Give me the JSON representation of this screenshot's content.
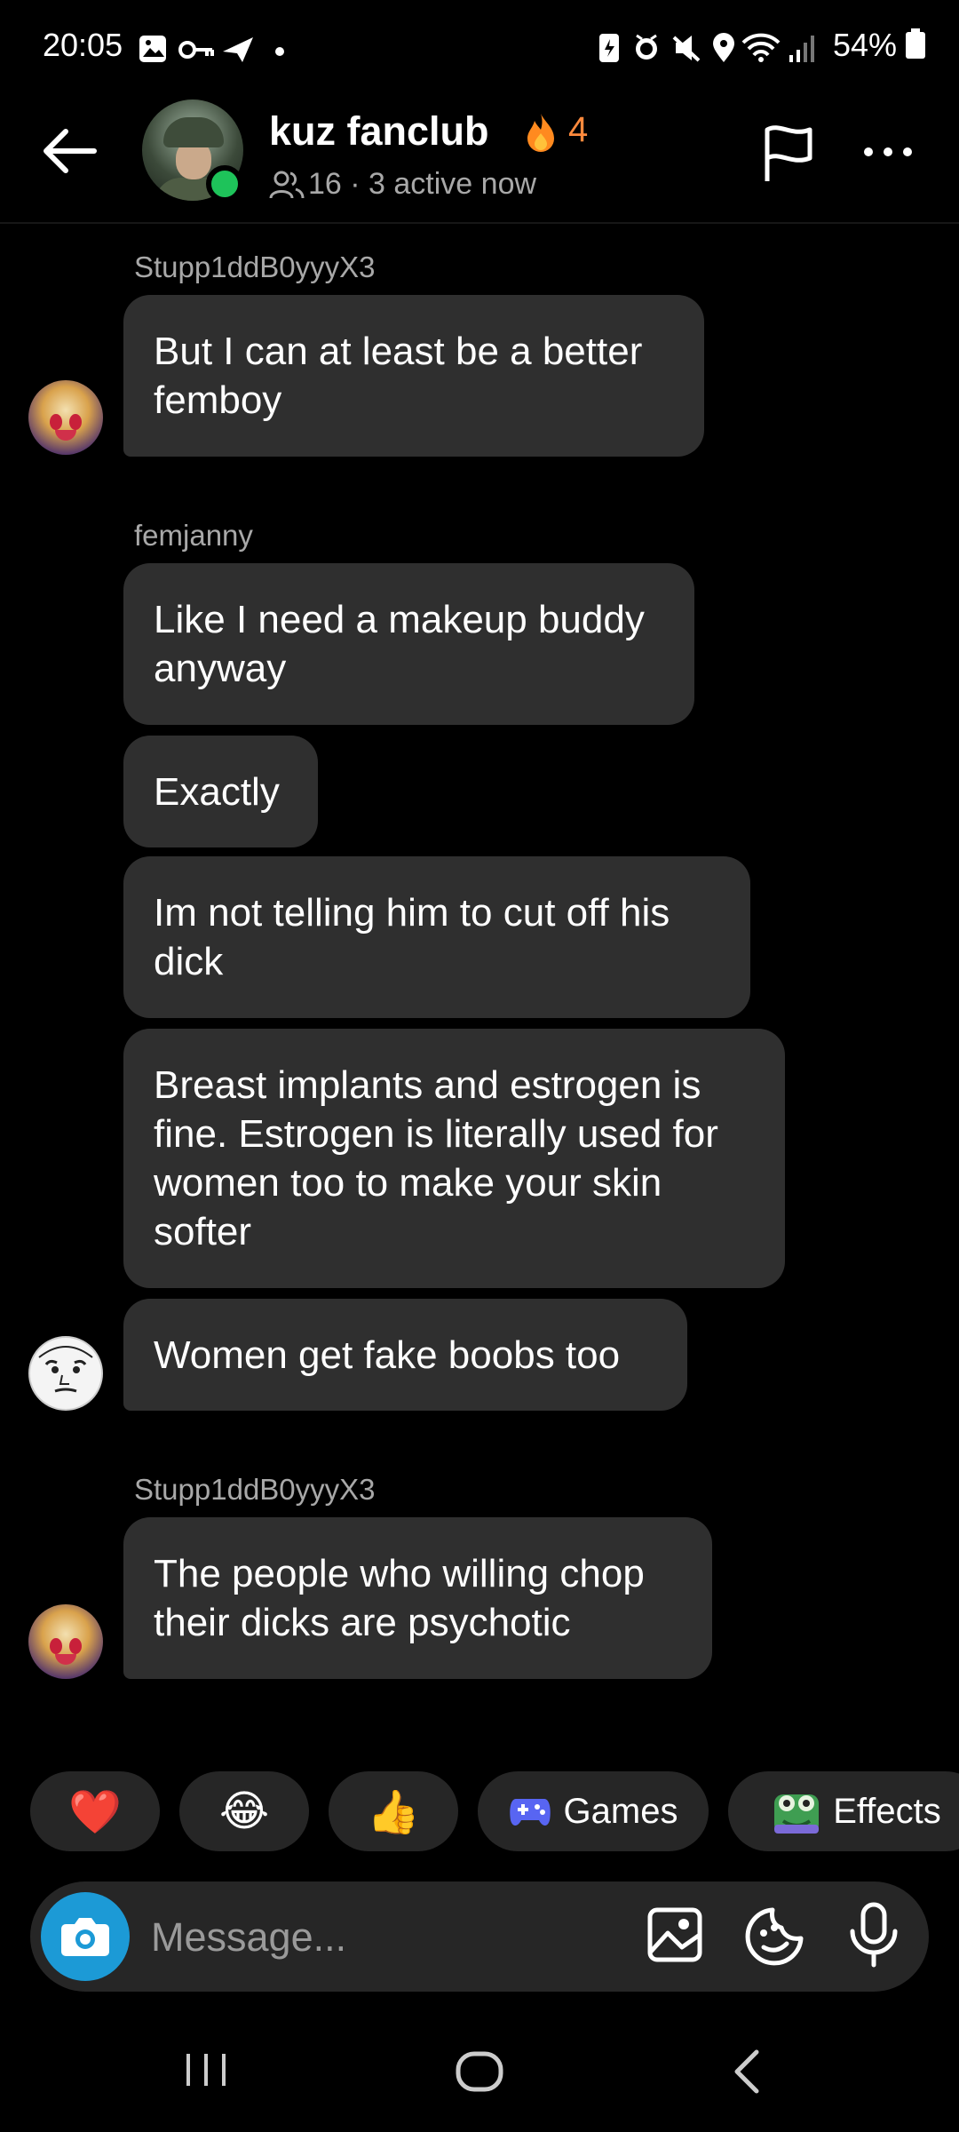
{
  "status_bar": {
    "time": "20:05",
    "battery": "54%"
  },
  "header": {
    "group_name": "kuz fanclub",
    "streak_count": "4",
    "member_info": "16 · 3 active now"
  },
  "messages": [
    {
      "sender": "Stupp1ddB0yyyX3",
      "text": "But I can at least be a better femboy"
    },
    {
      "sender": "femjanny",
      "text": "Like I need a makeup buddy anyway"
    },
    {
      "text": "Exactly"
    },
    {
      "text": "Im not telling him to cut off his dick"
    },
    {
      "text": "Breast implants and estrogen is fine. Estrogen is literally used for women too to make your skin softer"
    },
    {
      "text": "Women get fake boobs too"
    },
    {
      "sender": "Stupp1ddB0yyyX3",
      "text": "The people who willing chop their dicks are psychotic"
    }
  ],
  "quick_actions": [
    {
      "emoji": "❤️"
    },
    {
      "emoji": "😂"
    },
    {
      "emoji": "👍"
    },
    {
      "label": "Games",
      "icon": "gamepad-icon"
    },
    {
      "label": "Effects",
      "icon": "effects-icon"
    }
  ],
  "composer": {
    "placeholder": "Message..."
  },
  "colors": {
    "bubble": "#2f2f2f",
    "streak": "#ff8a3d",
    "online": "#1ec35a",
    "camera": "#1c9ad6"
  }
}
